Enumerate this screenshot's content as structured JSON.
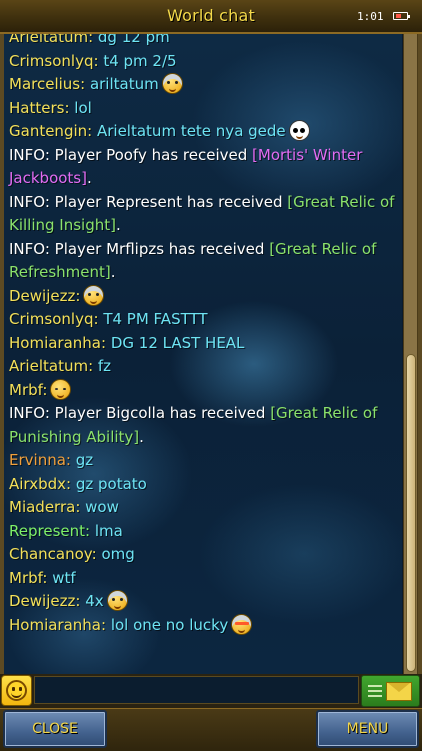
{
  "header": {
    "title": "World chat",
    "clock": "1:01"
  },
  "colors": {
    "title_text": "#f3d94a",
    "player_name_yellow": "#f3e05a",
    "player_name_green": "#7ef06a",
    "player_name_orange": "#f0a03c",
    "message_cyan": "#6ee4f4",
    "item_pink": "#e26cf2",
    "item_green": "#8be26c",
    "button_label": "#f2d64a"
  },
  "chat": {
    "messages": [
      {
        "name": "Arieltatum:",
        "text": "dg 12 pm"
      },
      {
        "name": "Crimsonlyq:",
        "text": "t4 pm 2/5"
      },
      {
        "name": "Marcelius:",
        "text": "ariltatum",
        "emoji": "shocked-viking-emoji"
      },
      {
        "name": "Hatters:",
        "text": "lol"
      },
      {
        "name": "Gantengin:",
        "text": "Arieltatum tete nya gede",
        "emoji": "panda-emoji"
      },
      {
        "name": "INFO:",
        "text": "Player Poofy has received",
        "item": "[Mortis' Winter Jackboots]",
        "end": "."
      },
      {
        "name": "INFO:",
        "text": "Player Represent has received",
        "item": "[Great Relic of Killing Insight]",
        "end": "."
      },
      {
        "name": "INFO:",
        "text": "Player Mrflipzs has received",
        "item": "[Great Relic of Refreshment]",
        "end": "."
      },
      {
        "name": "Dewijezz:",
        "text": "",
        "emoji": "viking-emoji"
      },
      {
        "name": "Crimsonlyq:",
        "text": "T4 PM FASTTT"
      },
      {
        "name": "Homiaranha:",
        "text": "DG 12 LAST HEAL"
      },
      {
        "name": "Arieltatum:",
        "text": "fz"
      },
      {
        "name": "Mrbf:",
        "text": "",
        "emoji": "sleeping-emoji"
      },
      {
        "name": "INFO:",
        "text": "Player Bigcolla has received",
        "item": "[Great Relic of Punishing Ability]",
        "end": "."
      },
      {
        "name": "Ervinna:",
        "text": "gz"
      },
      {
        "name": "Airxbdx:",
        "text": "gz potato"
      },
      {
        "name": "Miaderra:",
        "text": "wow"
      },
      {
        "name": "Represent:",
        "text": "lma"
      },
      {
        "name": "Chancanoy:",
        "text": "omg"
      },
      {
        "name": "Mrbf:",
        "text": "wtf"
      },
      {
        "name": "Dewijezz:",
        "text": "4x",
        "emoji": "shocked-viking-emoji"
      },
      {
        "name": "Homiaranha:",
        "text": "lol one no lucky",
        "emoji": "cool-viking-emoji"
      }
    ]
  },
  "input": {
    "value": "",
    "placeholder": ""
  },
  "footer": {
    "close_label": "CLOSE",
    "menu_label": "MENU"
  }
}
